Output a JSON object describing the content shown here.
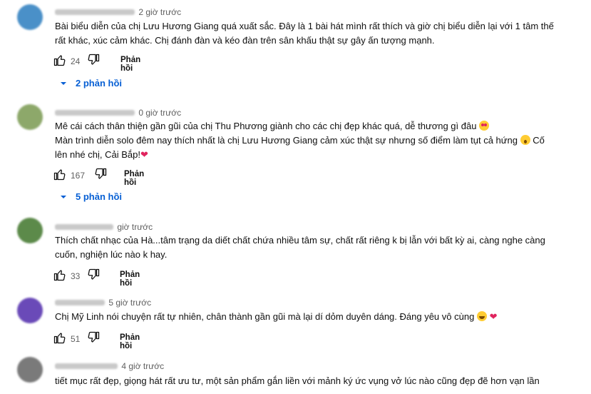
{
  "labels": {
    "reply": "Phản hồi"
  },
  "comments": [
    {
      "time": "2 giờ trước",
      "text_lines": [
        "Bài biểu diễn của chị Lưu Hương Giang quá xuất sắc. Đây là 1 bài hát mình rất thích và giờ chị biểu diễn lại với 1 tâm thế",
        "rất khác, xúc cảm khác. Chị đánh đàn và kéo đàn trên sân khấu thật sự gây ấn tượng mạnh."
      ],
      "likes": "24",
      "replies": "2 phản hồi"
    },
    {
      "time": "0 giờ trước",
      "text_lines": [
        "Mê cái cách thân thiện gần gũi của chị Thu Phương giành cho các chị đẹp khác quá, dễ thương gì đâu",
        "Màn trình diễn solo đêm nay thích nhất là chị Lưu Hương Giang cảm xúc thật sự nhưng số điểm làm tụt cả hứng",
        "Cố",
        "lên nhé chị, Cải Bắp!"
      ],
      "likes": "167",
      "replies": "5 phản hồi"
    },
    {
      "time": "giờ trước",
      "text_lines": [
        "Thích chất nhạc của Hà...tâm trạng da diết chất chứa nhiều tâm sự, chất rất riêng k bị lẫn với bất kỳ ai, càng nghe càng",
        "cuốn, nghiện lúc nào k hay."
      ],
      "likes": "33"
    },
    {
      "time": "5 giờ trước",
      "text_lines": [
        "Chị Mỹ Linh nói chuyện rất tự nhiên, chân thành gần gũi mà lại dí dỏm duyên dáng. Đáng yêu vô cùng"
      ],
      "likes": "51"
    },
    {
      "time": "4 giờ trước",
      "text_lines": [
        "tiết mục rất đẹp, giọng hát rất ưu tư, một sản phẩm gắn liền với mảnh ký ức vụng vở lúc nào cũng đẹp đẽ hơn vạn lần"
      ]
    }
  ],
  "icons": {
    "like": "thumb-up-icon",
    "dislike": "thumb-down-icon",
    "expand": "chevron-down-icon",
    "emoji_love": "heart-eyes-emoji",
    "emoji_wow": "astonished-emoji",
    "emoji_laugh": "laughing-emoji",
    "heart": "red-heart-emoji"
  },
  "colors": {
    "link_blue": "#065fd4",
    "meta_gray": "#606060",
    "text": "#0f0f0f",
    "heart_red": "#e0245e",
    "avatar_1": "#4a90c8",
    "avatar_2": "#8da86a",
    "avatar_3": "#5c8a4a",
    "avatar_4": "#6a4ab8",
    "avatar_5": "#7a7a7a"
  }
}
